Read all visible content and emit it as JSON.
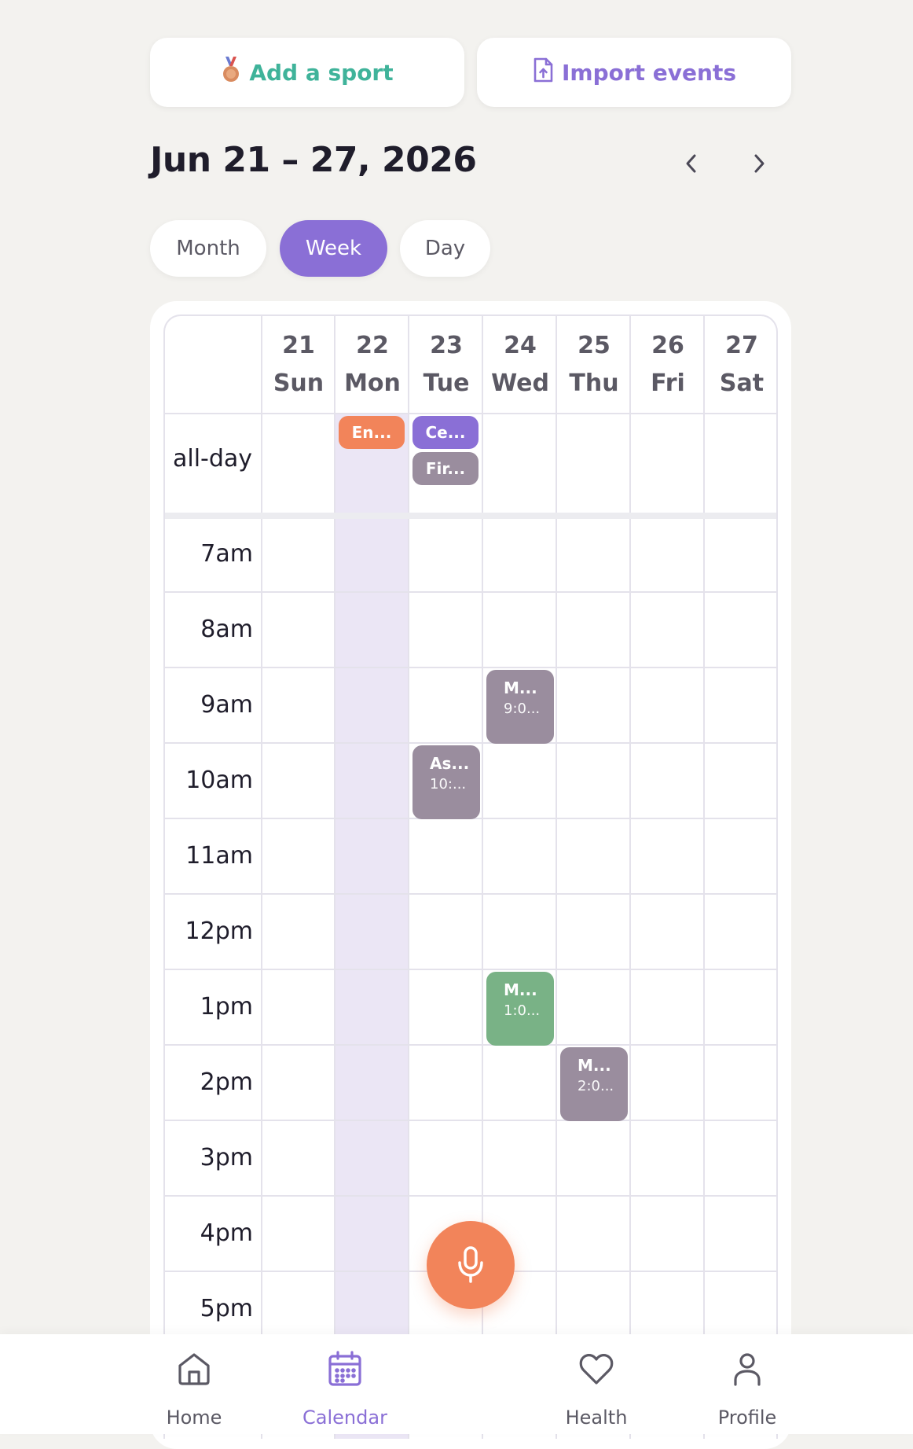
{
  "top_actions": {
    "add_sport_label": "Add a sport",
    "import_events_label": "Import events",
    "add_color": "#3fb39a",
    "import_color": "#8a6fd6"
  },
  "header": {
    "date_range": "Jun 21 – 27, 2026"
  },
  "view_switcher": {
    "month": "Month",
    "week": "Week",
    "day": "Day",
    "selected": "Week"
  },
  "calendar": {
    "days": [
      {
        "num": "21",
        "name": "Sun"
      },
      {
        "num": "22",
        "name": "Mon"
      },
      {
        "num": "23",
        "name": "Tue"
      },
      {
        "num": "24",
        "name": "Wed"
      },
      {
        "num": "25",
        "name": "Thu"
      },
      {
        "num": "26",
        "name": "Fri"
      },
      {
        "num": "27",
        "name": "Sat"
      }
    ],
    "today_day": "22",
    "all_day_label": "all-day",
    "hours": [
      "7am",
      "8am",
      "9am",
      "10am",
      "11am",
      "12pm",
      "1pm",
      "2pm",
      "3pm",
      "4pm",
      "5pm"
    ],
    "all_day_events": [
      {
        "title": "En...",
        "day": "22",
        "color": "#f2845a"
      },
      {
        "title": "Ce...",
        "day": "23",
        "color": "#8a6fd6"
      },
      {
        "title": "Fir...",
        "day": "23",
        "color": "#9a8d9e"
      }
    ],
    "timed_events": [
      {
        "title": "As...",
        "time": "10:...",
        "day": "23",
        "color": "#9a8d9e"
      },
      {
        "title": "M...",
        "time": "9:0...",
        "day": "24",
        "color": "#9a8d9e"
      },
      {
        "title": "M...",
        "time": "1:0...",
        "day": "24",
        "color": "#79b286"
      },
      {
        "title": "M...",
        "time": "2:0...",
        "day": "25",
        "color": "#9a8d9e"
      }
    ]
  },
  "fab": {
    "icon": "microphone-icon",
    "color": "#f2845a"
  },
  "bottom_nav": {
    "home": "Home",
    "calendar": "Calendar",
    "health": "Health",
    "profile": "Profile",
    "active": "Calendar",
    "accent": "#8a6fd6"
  }
}
